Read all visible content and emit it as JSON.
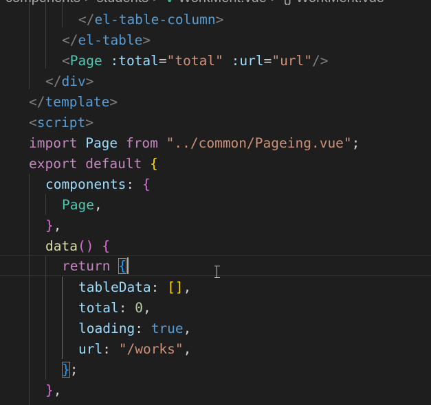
{
  "breadcrumb": {
    "segments": [
      "components",
      "students",
      "WorkMent.vue",
      "{}",
      "WorkMent.vue"
    ],
    "separator": ">",
    "vue_icon": "V"
  },
  "colors": {
    "background": "#1e1e1e",
    "tag_bracket": "#808080",
    "tag_name": "#569cd6",
    "component_tag": "#4ec9b0",
    "attribute": "#9cdcfe",
    "string": "#ce9178",
    "keyword": "#c586c0",
    "function": "#dcdcaa",
    "number": "#b5cea8",
    "bracket_level_1": "#ffd700",
    "bracket_level_2": "#da70d6",
    "bracket_level_3": "#179fff"
  },
  "code": {
    "l1": {
      "open": "</",
      "name": "el-table-column",
      "close": ">"
    },
    "l2": {
      "open": "</",
      "name": "el-table",
      "close": ">"
    },
    "l3": {
      "open": "<",
      "name": "Page",
      "attr1": ":total",
      "eq1": "=",
      "val1": "\"total\"",
      "attr2": ":url",
      "eq2": "=",
      "val2": "\"url\"",
      "close": "/>"
    },
    "l4": {
      "open": "</",
      "name": "div",
      "close": ">"
    },
    "l5": {
      "open": "</",
      "name": "template",
      "close": ">"
    },
    "l6": {
      "open": "<",
      "name": "script",
      "close": ">"
    },
    "l7": {
      "kw1": "import",
      "name": "Page",
      "kw2": "from",
      "path": "\"../common/Pageing.vue\"",
      "semi": ";"
    },
    "l8": {
      "kw1": "export",
      "kw2": "default",
      "brace": "{"
    },
    "l9": {
      "key": "components",
      "colon": ":",
      "brace": "{"
    },
    "l10": {
      "name": "Page",
      "comma": ","
    },
    "l11": {
      "brace": "}",
      "comma": ","
    },
    "l12": {
      "fn": "data",
      "parens": "()",
      "brace": "{"
    },
    "l13": {
      "kw": "return",
      "brace": "{"
    },
    "l14": {
      "key": "tableData",
      "colon": ":",
      "value": "[]",
      "comma": ","
    },
    "l15": {
      "key": "total",
      "colon": ":",
      "value": "0",
      "comma": ","
    },
    "l16": {
      "key": "loading",
      "colon": ":",
      "value": "true",
      "comma": ","
    },
    "l17": {
      "key": "url",
      "colon": ":",
      "value": "\"/works\"",
      "comma": ","
    },
    "l18": {
      "brace": "}",
      "semi": ";"
    },
    "l19": {
      "brace": "}",
      "comma": ","
    },
    "l20": {
      "brace": "}"
    }
  }
}
